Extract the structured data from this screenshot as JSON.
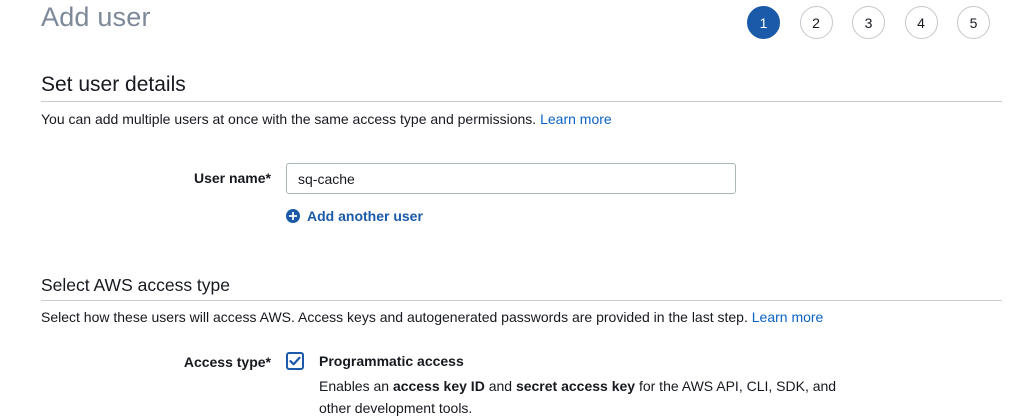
{
  "page": {
    "title": "Add user"
  },
  "steps": [
    "1",
    "2",
    "3",
    "4",
    "5"
  ],
  "active_step": "1",
  "user_details": {
    "title": "Set user details",
    "description": "You can add multiple users at once with the same access type and permissions.",
    "learn_more": "Learn more",
    "username_label": "User name*",
    "username_value": "sq-cache",
    "add_another_label": "Add another user"
  },
  "access_type": {
    "title": "Select AWS access type",
    "description": "Select how these users will access AWS. Access keys and autogenerated passwords are provided in the last step.",
    "learn_more": "Learn more",
    "label": "Access type*",
    "programmatic": {
      "checked": true,
      "title": "Programmatic access",
      "desc_prefix": "Enables an",
      "desc_bold1": "access key ID",
      "desc_and": "and",
      "desc_bold2": "secret access key",
      "desc_suffix": "for the AWS API, CLI, SDK, and other development tools."
    }
  },
  "colors": {
    "accent": "#1a5aa8",
    "link": "#0b63c4",
    "title_gray": "#7d8998"
  },
  "icons": {
    "add": "plus-circle-icon",
    "check": "checkmark-icon"
  }
}
